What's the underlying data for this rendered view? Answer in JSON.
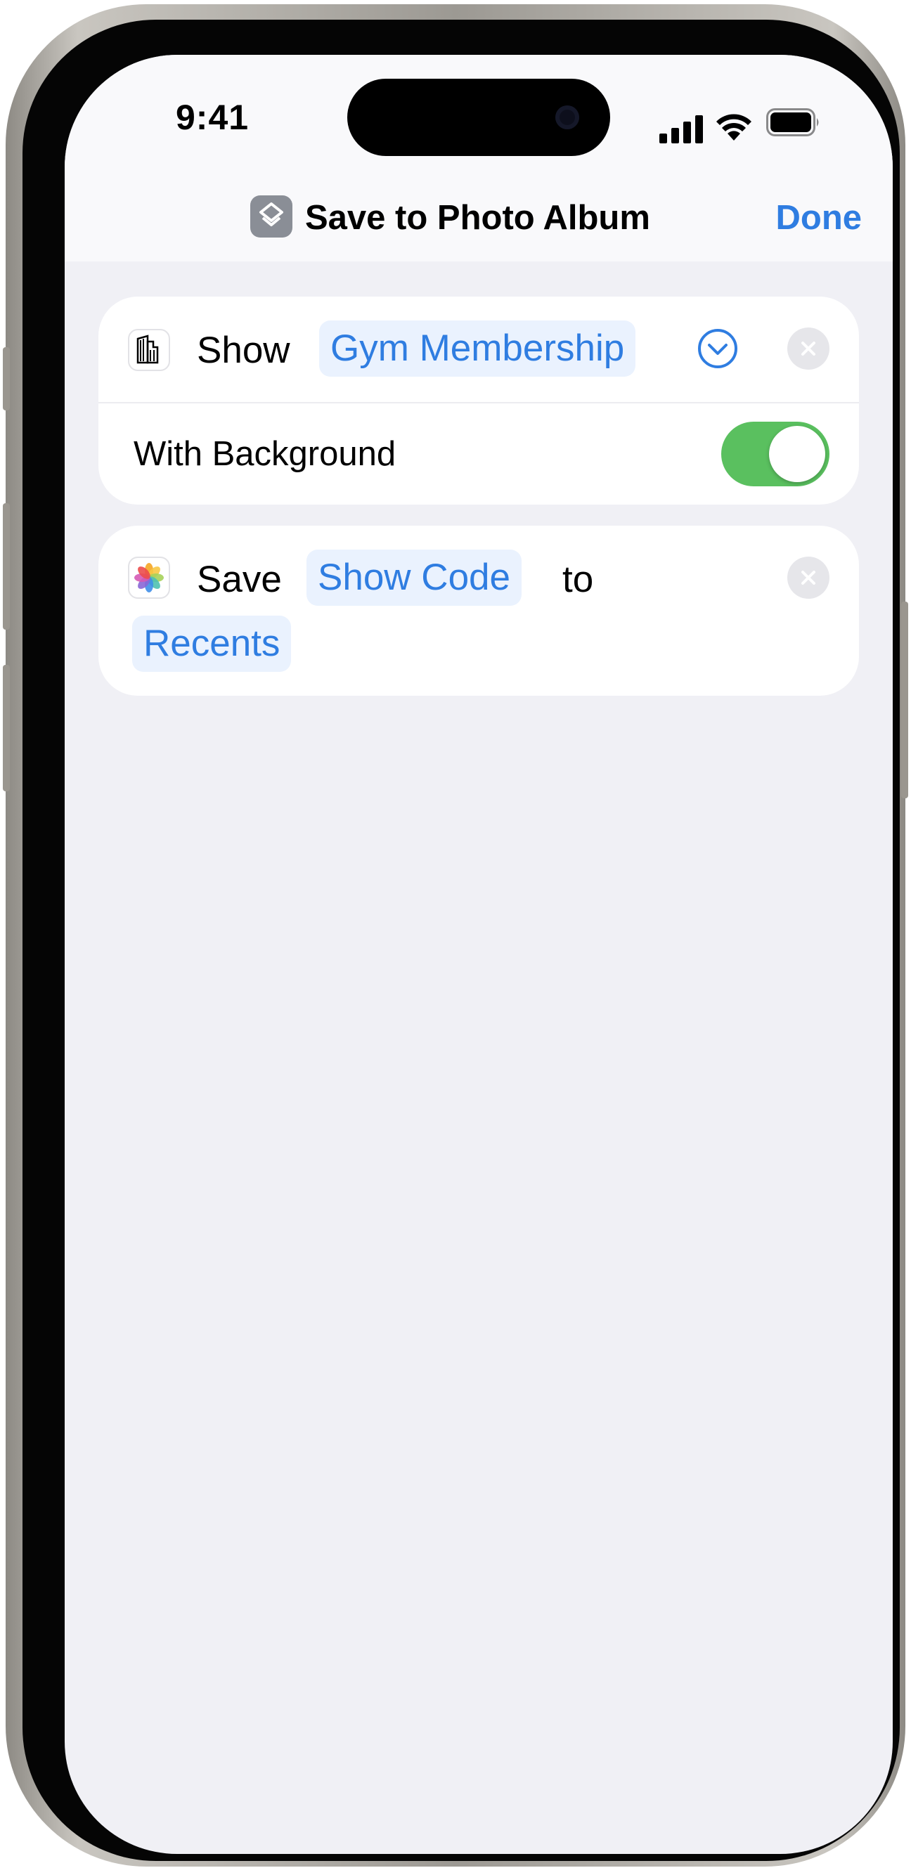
{
  "status_bar": {
    "time": "9:41"
  },
  "nav": {
    "title": "Save to Photo Album",
    "done_label": "Done",
    "icon": "shortcuts-icon"
  },
  "actions": [
    {
      "verb": "Show",
      "parameter": "Gym Membership",
      "icon": "wallet-pass-icon",
      "option_label": "With Background",
      "option_enabled": true
    },
    {
      "verb": "Save",
      "parameter": "Show Code",
      "connector": "to",
      "destination": "Recents",
      "icon": "photos-icon"
    }
  ],
  "colors": {
    "accent": "#2f7de1",
    "toggle_on": "#5ac05f",
    "background": "#f0f0f5"
  }
}
